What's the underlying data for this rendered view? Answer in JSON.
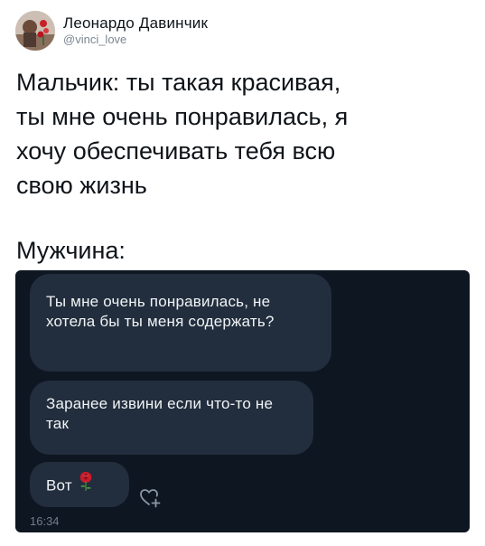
{
  "tweet": {
    "author_name": "Леонардо Давинчик",
    "author_handle": "@vinci_love",
    "text": "Мальчик: ты такая красивая,\nты мне очень понравилась, я\nхочу обеспечивать тебя всю\nсвою жизнь",
    "section_label": "Мужчина:"
  },
  "chat": {
    "messages": [
      {
        "text": "Ты мне очень понравилась, не хотела бы ты меня содержать?"
      },
      {
        "text": "Заранее извини если что-то не так"
      },
      {
        "text": "Вот",
        "emoji": "rose-icon"
      }
    ],
    "reaction_icon": "heart-plus-icon",
    "time": "16:34"
  },
  "colors": {
    "chat_background": "#0e1621",
    "bubble": "#222e3d",
    "bubble_text": "#f1f4f7",
    "handle": "#7a8791",
    "time": "#6f7d8c"
  }
}
